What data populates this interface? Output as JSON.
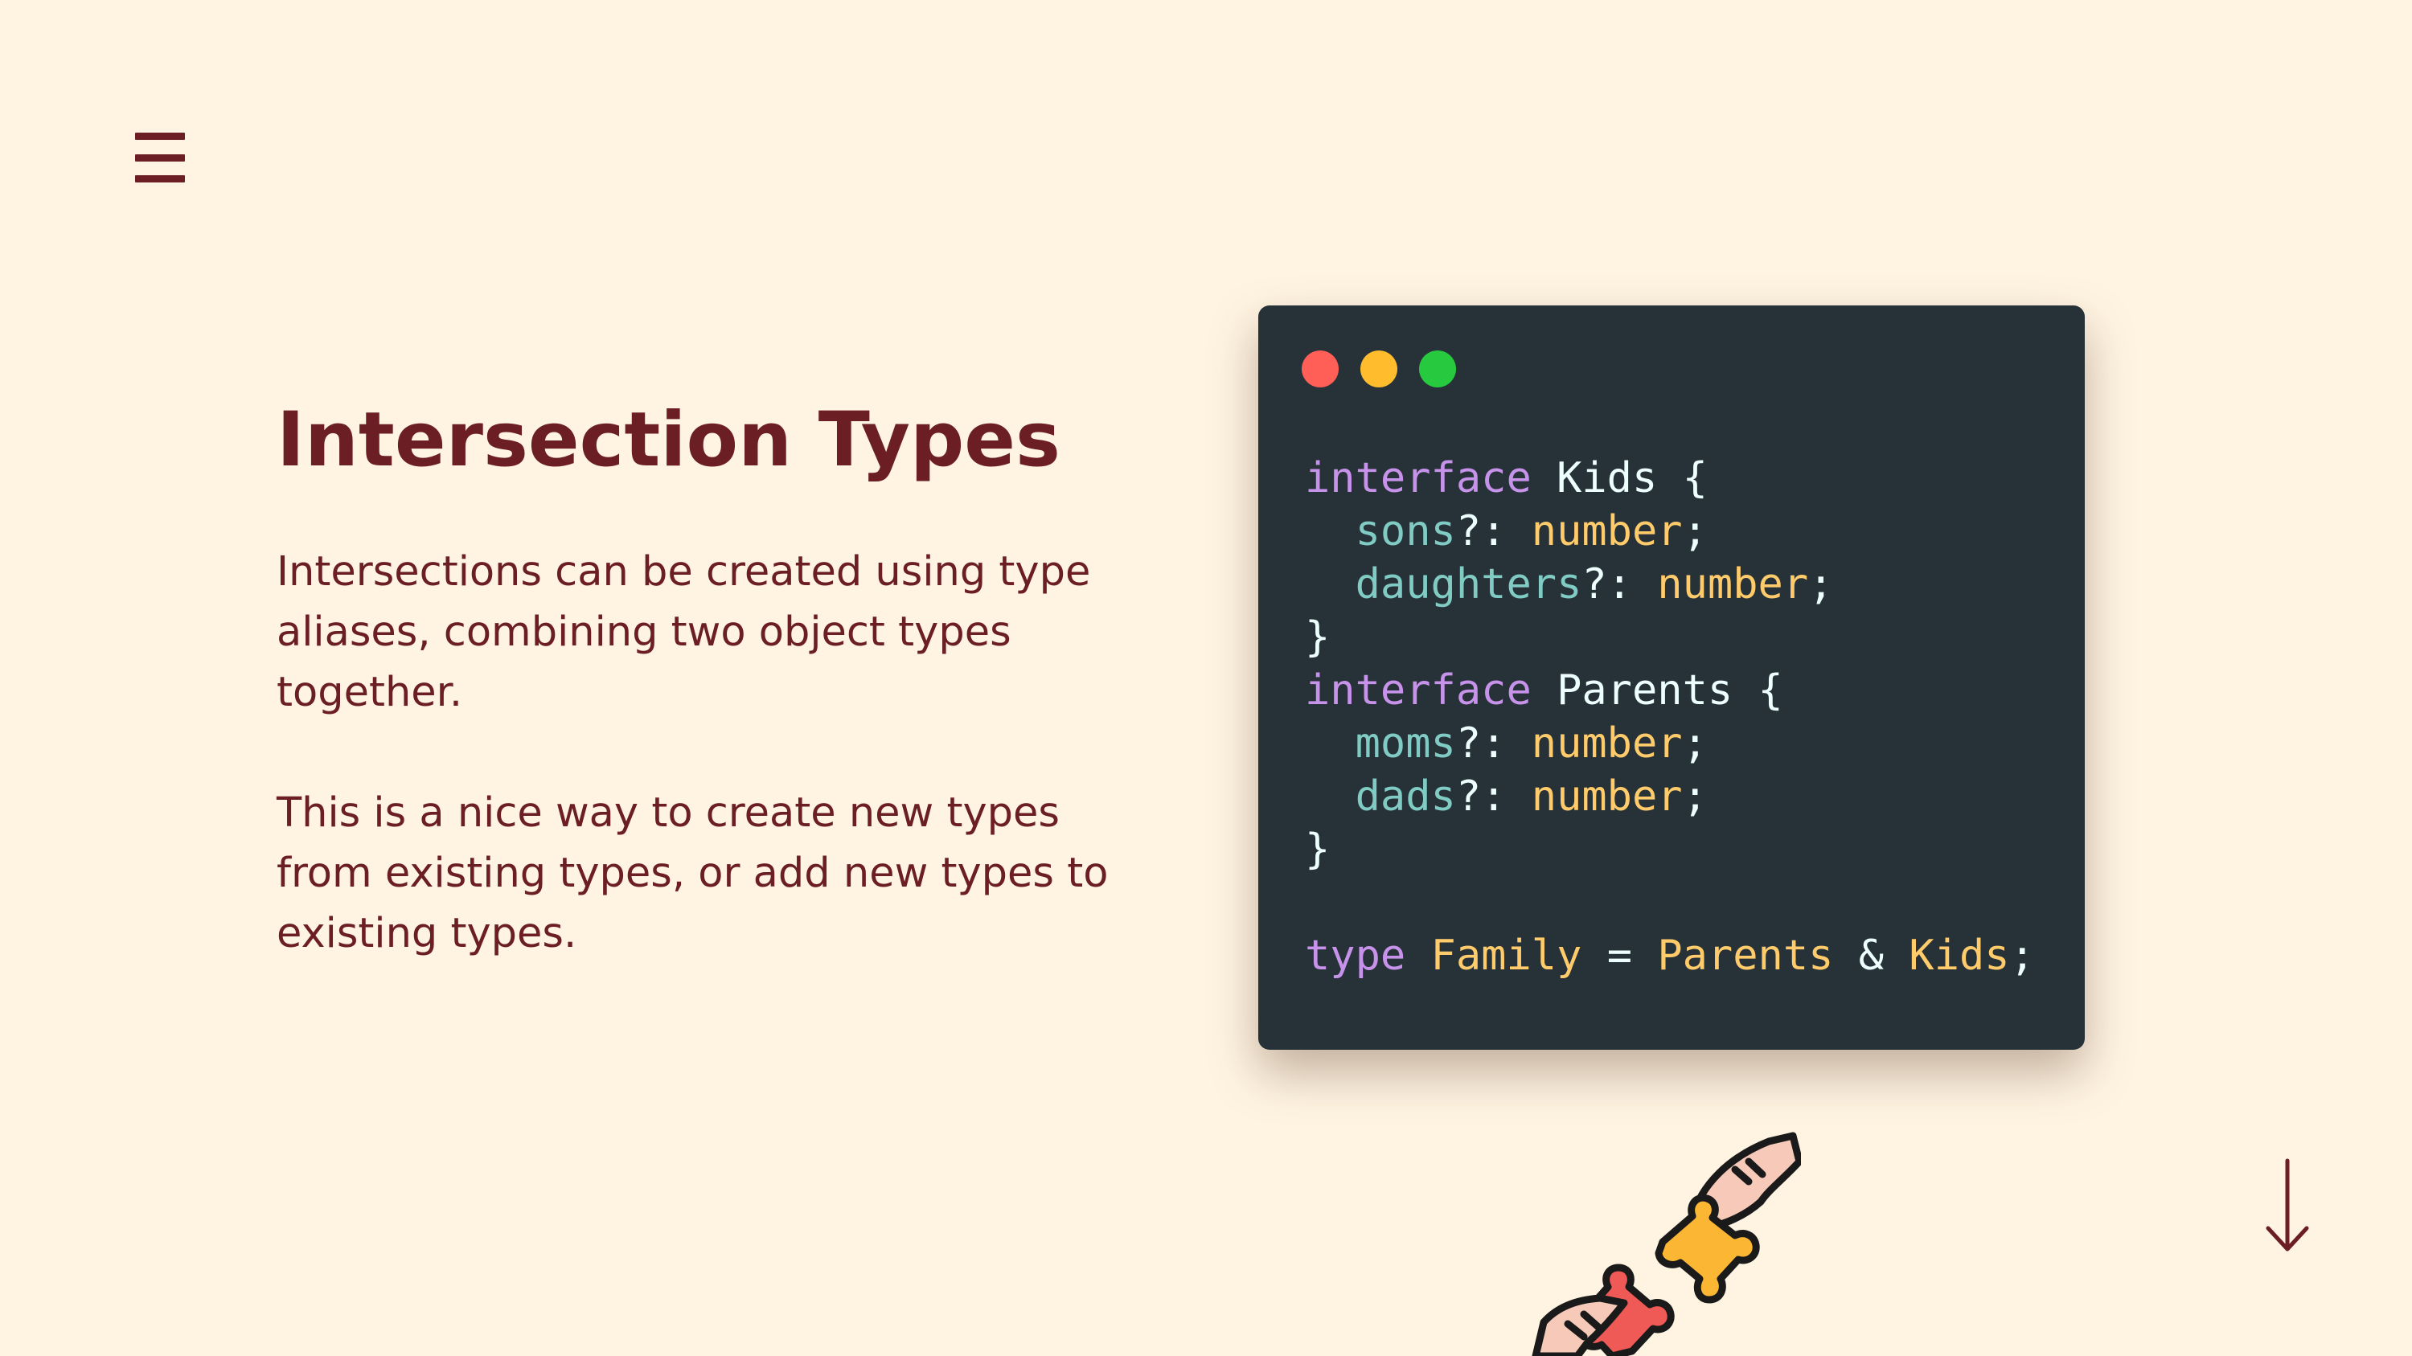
{
  "slide": {
    "title": "Intersection Types",
    "paragraphs": [
      "Intersections can be created using type aliases, combining two object types together.",
      "This is a nice way to create new types from existing types, or add new types to existing types."
    ]
  },
  "code": {
    "lines": [
      [
        {
          "t": "interface",
          "c": "kw"
        },
        {
          "t": " Kids {",
          "c": "pl"
        }
      ],
      [
        {
          "t": "  sons",
          "c": "prop"
        },
        {
          "t": "?: ",
          "c": "pl"
        },
        {
          "t": "number",
          "c": "ty"
        },
        {
          "t": ";",
          "c": "pl"
        }
      ],
      [
        {
          "t": "  daughters",
          "c": "prop"
        },
        {
          "t": "?: ",
          "c": "pl"
        },
        {
          "t": "number",
          "c": "ty"
        },
        {
          "t": ";",
          "c": "pl"
        }
      ],
      [
        {
          "t": "}",
          "c": "pl"
        }
      ],
      [
        {
          "t": "interface",
          "c": "kw"
        },
        {
          "t": " Parents {",
          "c": "pl"
        }
      ],
      [
        {
          "t": "  moms",
          "c": "prop"
        },
        {
          "t": "?: ",
          "c": "pl"
        },
        {
          "t": "number",
          "c": "ty"
        },
        {
          "t": ";",
          "c": "pl"
        }
      ],
      [
        {
          "t": "  dads",
          "c": "prop"
        },
        {
          "t": "?: ",
          "c": "pl"
        },
        {
          "t": "number",
          "c": "ty"
        },
        {
          "t": ";",
          "c": "pl"
        }
      ],
      [
        {
          "t": "}",
          "c": "pl"
        }
      ],
      [],
      [
        {
          "t": "type",
          "c": "kw"
        },
        {
          "t": " ",
          "c": "pl"
        },
        {
          "t": "Family",
          "c": "ty"
        },
        {
          "t": " = ",
          "c": "pl"
        },
        {
          "t": "Parents",
          "c": "ty"
        },
        {
          "t": " & ",
          "c": "pl"
        },
        {
          "t": "Kids",
          "c": "ty"
        },
        {
          "t": ";",
          "c": "pl"
        }
      ]
    ]
  },
  "icons": {
    "menu": "hamburger-menu-icon",
    "next": "arrow-down-icon",
    "illustration": "puzzle-hands-icon",
    "window_controls": [
      "close-dot",
      "minimize-dot",
      "maximize-dot"
    ]
  },
  "colors": {
    "background": "#FFF4E2",
    "accent": "#6B1E24",
    "code_background": "#263238",
    "keyword": "#C792EA",
    "property": "#80CBC4",
    "type": "#FFCB6B",
    "plain": "#EEFFFF",
    "dot_red": "#FF5F56",
    "dot_yellow": "#FFBD2E",
    "dot_green": "#27C93F"
  }
}
